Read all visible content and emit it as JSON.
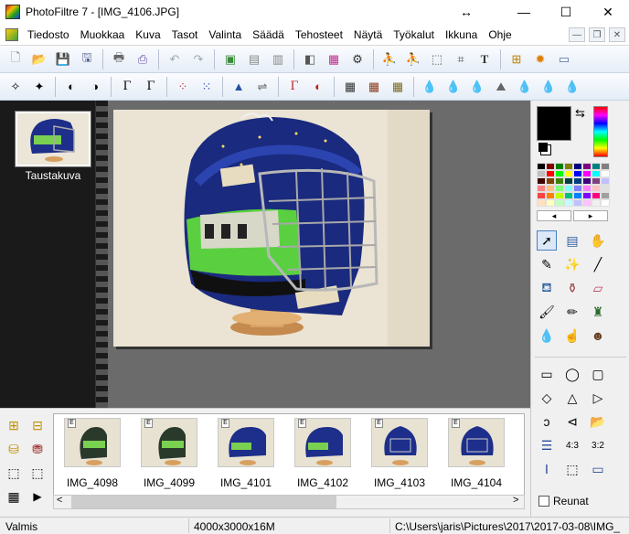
{
  "window": {
    "title": "PhotoFiltre 7 - [IMG_4106.JPG]",
    "minimize_glyph": "—",
    "restore_glyph": "☐",
    "close_glyph": "✕",
    "resize_glyph": "↔"
  },
  "menu": [
    "Tiedosto",
    "Muokkaa",
    "Kuva",
    "Tasot",
    "Valinta",
    "Säädä",
    "Tehosteet",
    "Näytä",
    "Työkalut",
    "Ikkuna",
    "Ohje"
  ],
  "layers": {
    "background_label": "Taustakuva"
  },
  "explorer": {
    "badge": "E",
    "thumbnails": [
      "IMG_4098",
      "IMG_4099",
      "IMG_4101",
      "IMG_4102",
      "IMG_4103",
      "IMG_4104"
    ],
    "scroll_left": "<",
    "scroll_right": ">"
  },
  "palette": {
    "reunat_label": "Reunat",
    "scroll_left": "◂",
    "scroll_right": "▸",
    "swatches": [
      "#000000",
      "#800000",
      "#008000",
      "#808000",
      "#000080",
      "#800080",
      "#008080",
      "#808080",
      "#c0c0c0",
      "#ff0000",
      "#00ff00",
      "#ffff00",
      "#0000ff",
      "#ff00ff",
      "#00ffff",
      "#ffffff",
      "#400000",
      "#804000",
      "#408000",
      "#004040",
      "#004080",
      "#400080",
      "#804080",
      "#c0c0ff",
      "#ff8080",
      "#ffc080",
      "#80ff80",
      "#80ffff",
      "#8080ff",
      "#ff80ff",
      "#ffc0c0",
      "#e0e0e0",
      "#ff4040",
      "#ff8000",
      "#c0ff00",
      "#00c080",
      "#0080ff",
      "#8000ff",
      "#ff0080",
      "#a0a0a0",
      "#ffe0c0",
      "#ffffc0",
      "#c0ffc0",
      "#c0ffff",
      "#c0c0ff",
      "#ffc0ff",
      "#f0f0f0",
      "#ffffff"
    ]
  },
  "status": {
    "state": "Valmis",
    "dimensions": "4000x3000x16M",
    "path": "C:\\Users\\jaris\\Pictures\\2017\\2017-03-08\\IMG_"
  }
}
